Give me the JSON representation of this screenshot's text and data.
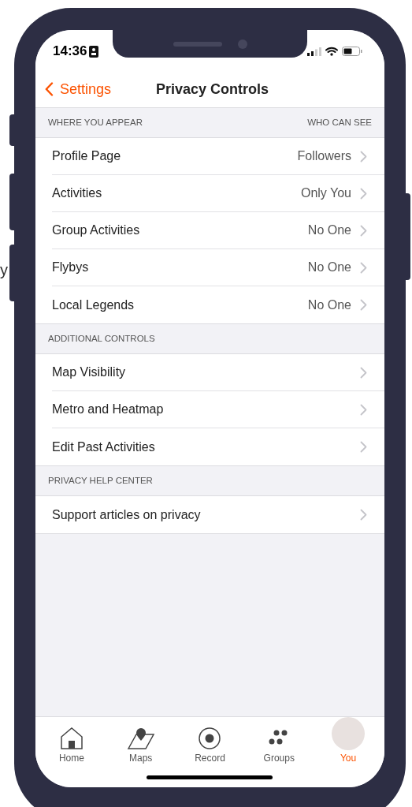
{
  "stray_text": "y",
  "status_bar": {
    "time": "14:36"
  },
  "nav": {
    "back": "Settings",
    "title": "Privacy Controls"
  },
  "sections": [
    {
      "title": "WHERE YOU APPEAR",
      "column_title": "WHO CAN SEE",
      "rows": [
        {
          "label": "Profile Page",
          "value": "Followers"
        },
        {
          "label": "Activities",
          "value": "Only You"
        },
        {
          "label": "Group Activities",
          "value": "No One"
        },
        {
          "label": "Flybys",
          "value": "No One"
        },
        {
          "label": "Local Legends",
          "value": "No One"
        }
      ]
    },
    {
      "title": "ADDITIONAL CONTROLS",
      "rows": [
        {
          "label": "Map Visibility"
        },
        {
          "label": "Metro and Heatmap"
        },
        {
          "label": "Edit Past Activities"
        }
      ]
    },
    {
      "title": "PRIVACY HELP CENTER",
      "rows": [
        {
          "label": "Support articles on privacy"
        }
      ]
    }
  ],
  "tab_bar": [
    {
      "kind": "home",
      "label": "Home",
      "selected": false
    },
    {
      "kind": "maps",
      "label": "Maps",
      "selected": false
    },
    {
      "kind": "record",
      "label": "Record",
      "selected": false
    },
    {
      "kind": "groups",
      "label": "Groups",
      "selected": false
    },
    {
      "kind": "you",
      "label": "You",
      "selected": true
    }
  ]
}
